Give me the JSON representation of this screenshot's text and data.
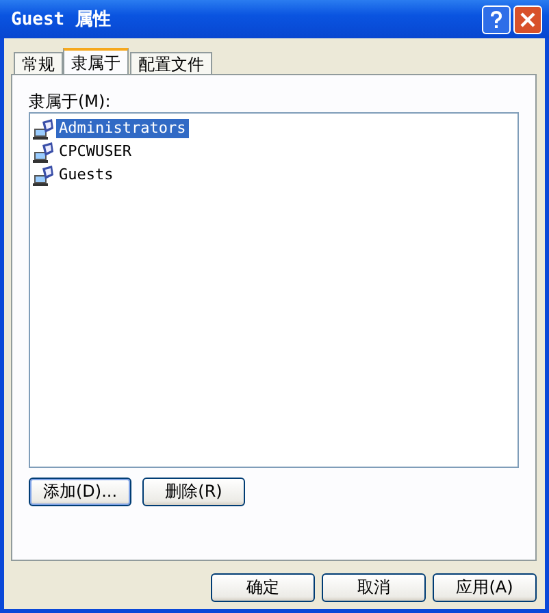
{
  "window": {
    "title": "Guest 属性"
  },
  "tabs": [
    {
      "label": "常规",
      "selected": false
    },
    {
      "label": "隶属于",
      "selected": true
    },
    {
      "label": "配置文件",
      "selected": false
    }
  ],
  "member_label": "隶属于(M):",
  "members": [
    {
      "name": "Administrators",
      "selected": true
    },
    {
      "name": "CPCWUSER",
      "selected": false
    },
    {
      "name": "Guests",
      "selected": false
    }
  ],
  "list_buttons": [
    {
      "label": "添加(D)...",
      "default": true
    },
    {
      "label": "删除(R)",
      "default": false
    }
  ],
  "dialog_buttons": [
    "确定",
    "取消",
    "应用(A)"
  ]
}
